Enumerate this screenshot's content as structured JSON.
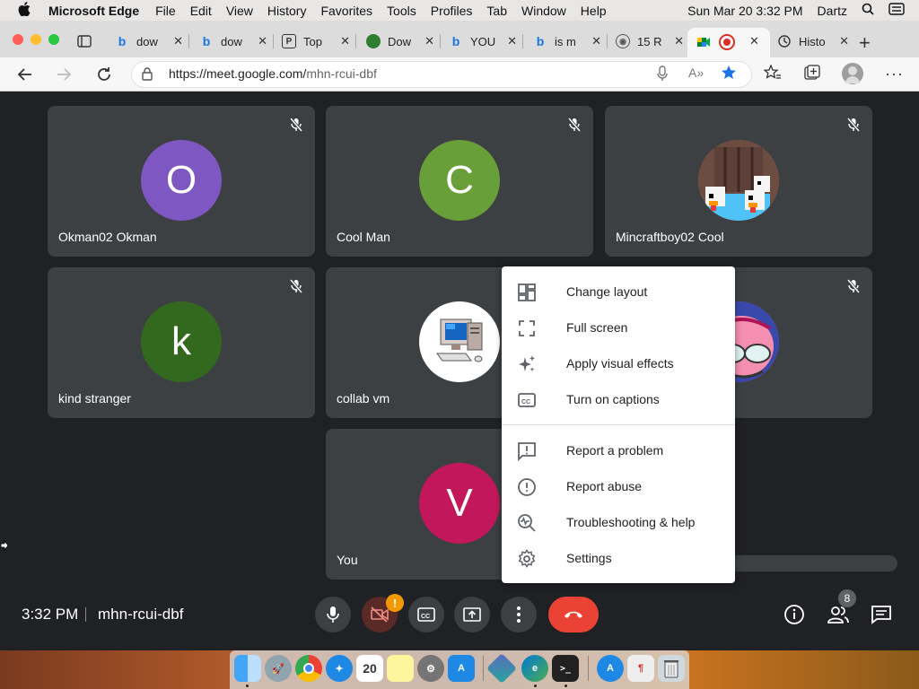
{
  "menubar": {
    "app_name": "Microsoft Edge",
    "items": [
      "File",
      "Edit",
      "View",
      "History",
      "Favorites",
      "Tools",
      "Profiles",
      "Tab",
      "Window",
      "Help"
    ],
    "datetime": "Sun Mar 20  3:32 PM",
    "user": "Dartz"
  },
  "tabs": [
    {
      "label": "dow",
      "icon": "bing-icon"
    },
    {
      "label": "dow",
      "icon": "bing-icon"
    },
    {
      "label": "Top",
      "icon": "page-icon"
    },
    {
      "label": "Dow",
      "icon": "edge-download-icon"
    },
    {
      "label": "YOU",
      "icon": "bing-icon"
    },
    {
      "label": "is m",
      "icon": "bing-icon"
    },
    {
      "label": "15 R",
      "icon": "reddit-icon"
    },
    {
      "label": "",
      "icon": "meet-icon",
      "active": true
    },
    {
      "label": "Histo",
      "icon": "history-icon"
    }
  ],
  "address": {
    "url_host": "https://meet.google.com/",
    "url_path": "mhn-rcui-dbf"
  },
  "participants": [
    {
      "name": "Okman02 Okman",
      "initial": "O",
      "color": "#7e57c2"
    },
    {
      "name": "Cool Man",
      "initial": "C",
      "color": "#689f38"
    },
    {
      "name": "Mincraftboy02 Cool",
      "initial": "",
      "color": "#8d6e63"
    },
    {
      "name": "kind stranger",
      "initial": "k",
      "color": "#33691e"
    },
    {
      "name": "collab vm",
      "initial": "",
      "color": "#ffffff"
    },
    {
      "name": "",
      "initial": "",
      "color": "#ec407a"
    },
    {
      "name": "You",
      "initial": "V",
      "color": "#c2185b"
    }
  ],
  "menu": {
    "items": [
      {
        "label": "Change layout",
        "icon": "layout-icon"
      },
      {
        "label": "Full screen",
        "icon": "fullscreen-icon"
      },
      {
        "label": "Apply visual effects",
        "icon": "sparkle-icon"
      },
      {
        "label": "Turn on captions",
        "icon": "captions-icon"
      },
      {
        "label": "Report a problem",
        "icon": "feedback-icon"
      },
      {
        "label": "Report abuse",
        "icon": "alert-icon"
      },
      {
        "label": "Troubleshooting & help",
        "icon": "troubleshoot-icon"
      },
      {
        "label": "Settings",
        "icon": "gear-icon"
      }
    ]
  },
  "footer": {
    "time": "3:32 PM",
    "meeting_code": "mhn-rcui-dbf",
    "people_count": "8",
    "camera_alert": "!"
  },
  "colors": {
    "meet_bg": "#202124",
    "tile_bg": "#3c4043",
    "end_call": "#ea4335",
    "camera_off": "#5a2a27"
  }
}
